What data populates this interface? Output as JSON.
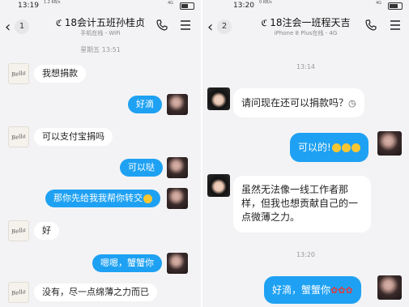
{
  "left": {
    "status": {
      "time": "13:19",
      "extra": "1.2\nKB/s",
      "network": "4G"
    },
    "header": {
      "back_count": "1",
      "title": "18会计五班孙桂贞",
      "subtitle": "手机在线 - WiFi"
    },
    "timestamp": "星期五 13:51",
    "messages": [
      {
        "side": "in",
        "text": "我想捐款"
      },
      {
        "side": "out",
        "text": "好滴"
      },
      {
        "side": "in",
        "text": "可以支付宝捐吗"
      },
      {
        "side": "out",
        "text": "可以哒"
      },
      {
        "side": "out",
        "text": "那你先给我我帮你转交",
        "emoji": "smile-emoji"
      },
      {
        "side": "in",
        "text": "好"
      },
      {
        "side": "out",
        "text": "嗯嗯，蟹蟹你"
      },
      {
        "side": "in",
        "text": "没有，尽一点绵薄之力而已"
      }
    ],
    "avatar_signature": "Bella"
  },
  "right": {
    "status": {
      "time": "13:20",
      "extra": "0\nKB/s",
      "network": "4G"
    },
    "header": {
      "back_count": "2",
      "title": "18注会一班程天吉",
      "subtitle": "iPhone 8 Plus在线 - 4G"
    },
    "timestamp1": "13:14",
    "timestamp2": "13:20",
    "messages": [
      {
        "side": "in",
        "text": "请问现在还可以捐款吗？",
        "emoji": "wait-emoji"
      },
      {
        "side": "out",
        "text": "可以的!",
        "emoji": "smile-emoji x3"
      },
      {
        "side": "in",
        "lines": [
          "虽然无法像一线工作者那",
          "样，但我也想贡献自己的一",
          "点微薄之力。"
        ]
      },
      {
        "side": "out",
        "text": "好滴，蟹蟹你",
        "emoji": "rose-emoji x3"
      }
    ]
  },
  "colors": {
    "outgoing_bubble": "#1ea1f3",
    "incoming_bubble": "#ffffff",
    "background": "#f3f3f5"
  }
}
